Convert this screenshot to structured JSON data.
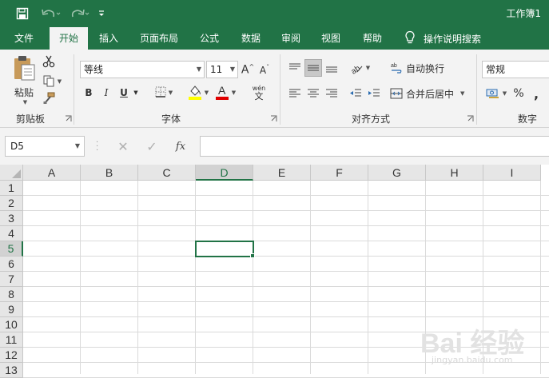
{
  "window": {
    "title": "工作簿1"
  },
  "quick_access": {
    "icons": [
      "save-icon",
      "undo-icon",
      "redo-icon",
      "customize-qat-icon"
    ]
  },
  "tabs": [
    {
      "label": "文件",
      "active": false
    },
    {
      "label": "开始",
      "active": true
    },
    {
      "label": "插入",
      "active": false
    },
    {
      "label": "页面布局",
      "active": false
    },
    {
      "label": "公式",
      "active": false
    },
    {
      "label": "数据",
      "active": false
    },
    {
      "label": "审阅",
      "active": false
    },
    {
      "label": "视图",
      "active": false
    },
    {
      "label": "帮助",
      "active": false
    }
  ],
  "tell_me": {
    "label": "操作说明搜索",
    "icon": "lightbulb-icon"
  },
  "ribbon": {
    "clipboard": {
      "label": "剪贴板",
      "paste_label": "粘贴"
    },
    "font": {
      "label": "字体",
      "font_name": "等线",
      "font_size": "11",
      "bold": "B",
      "italic": "I",
      "underline": "U",
      "phonetic": "wén",
      "font_color": "#e00000",
      "fill_color": "#ffff00"
    },
    "alignment": {
      "label": "对齐方式",
      "wrap_text": "自动换行",
      "merge_center": "合并后居中"
    },
    "number": {
      "label": "数字",
      "format": "常规",
      "percent": "%"
    }
  },
  "formula_bar": {
    "name_box": "D5",
    "fx": "fx",
    "formula": ""
  },
  "grid": {
    "columns": [
      "A",
      "B",
      "C",
      "D",
      "E",
      "F",
      "G",
      "H",
      "I"
    ],
    "rows": [
      "1",
      "2",
      "3",
      "4",
      "5",
      "6",
      "7",
      "8",
      "9",
      "10",
      "11",
      "12",
      "13"
    ],
    "selected_column": "D",
    "selected_row": "5",
    "accent_color": "#217346"
  },
  "watermark": {
    "text": "Bai 经验",
    "url_text": "jingyan.baidu.com"
  }
}
